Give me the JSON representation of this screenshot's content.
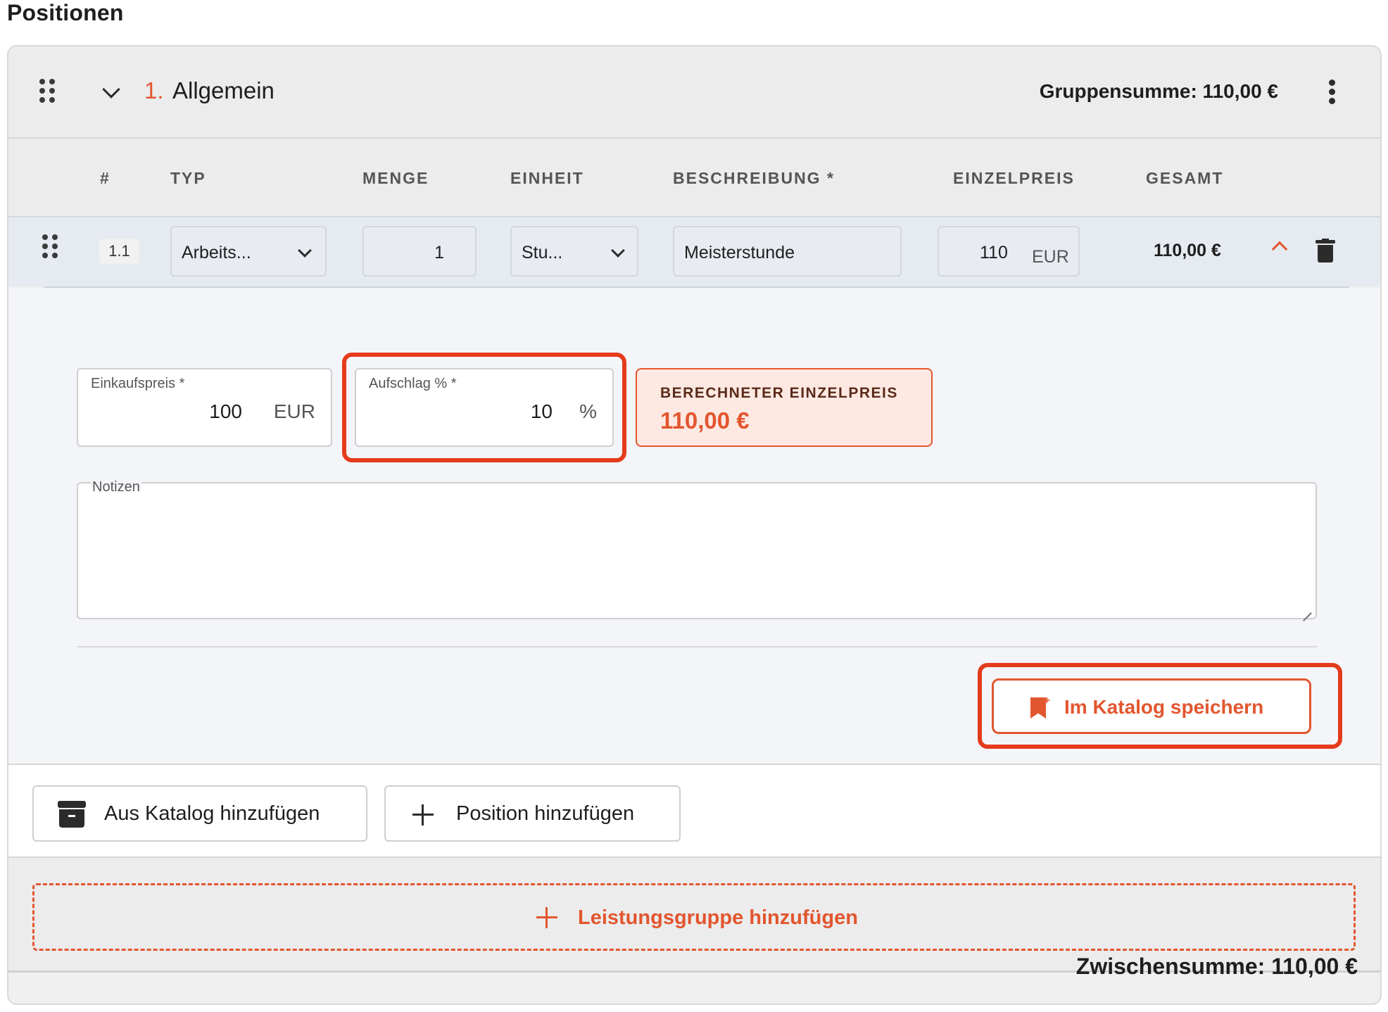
{
  "section": {
    "title": "Positionen"
  },
  "group": {
    "number": "1.",
    "name": "Allgemein",
    "sum": "Gruppensumme: 110,00 €"
  },
  "columns": {
    "pos": "#",
    "typ": "TYP",
    "menge": "MENGE",
    "einheit": "EINHEIT",
    "beschreibung": "BESCHREIBUNG *",
    "einzelpreis": "EINZELPREIS",
    "gesamt": "GESAMT"
  },
  "item": {
    "pos": "1.1",
    "typ": "Arbeits...",
    "menge": "1",
    "einheit": "Stu...",
    "beschreibung": "Meisterstunde",
    "einzelpreis": "110",
    "currency": "EUR",
    "gesamt": "110,00 €"
  },
  "detail": {
    "einkaufspreis_label": "Einkaufspreis *",
    "einkaufspreis_value": "100",
    "einkaufspreis_unit": "EUR",
    "aufschlag_label": "Aufschlag % *",
    "aufschlag_value": "10",
    "aufschlag_unit": "%",
    "calc_label": "BERECHNETER EINZELPREIS",
    "calc_value": "110,00 €",
    "notes_label": "Notizen",
    "notes_value": "",
    "save_catalog_label": "Im Katalog speichern"
  },
  "actions": {
    "from_catalog": "Aus Katalog hinzufügen",
    "add_position": "Position hinzufügen",
    "add_group": "Leistungsgruppe hinzufügen"
  },
  "footer": {
    "subtotal": "Zwischensumme: 110,00 €"
  },
  "colors": {
    "accent": "#e2562f",
    "highlight": "#e43b1c",
    "row_bg": "#e6eaf1"
  }
}
